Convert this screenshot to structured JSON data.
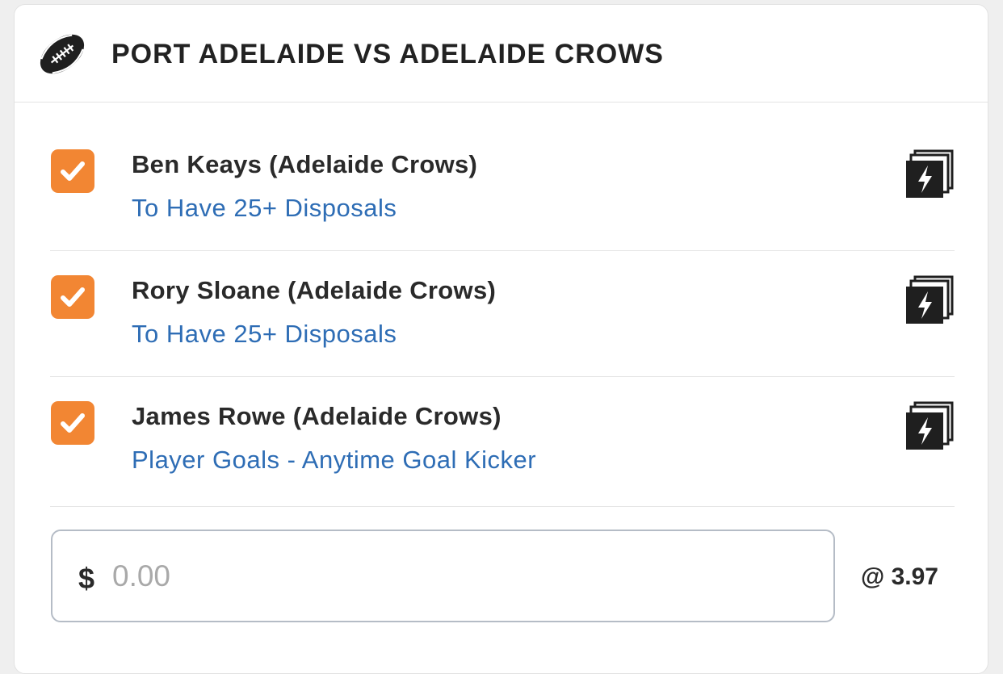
{
  "match": {
    "title": "PORT ADELAIDE VS ADELAIDE CROWS",
    "icon": "football-icon"
  },
  "selections": [
    {
      "player": "Ben Keays (Adelaide Crows)",
      "market": "To Have 25+ Disposals",
      "checked": true
    },
    {
      "player": "Rory Sloane (Adelaide Crows)",
      "market": "To Have 25+ Disposals",
      "checked": true
    },
    {
      "player": "James Rowe (Adelaide Crows)",
      "market": "Player Goals - Anytime Goal Kicker",
      "checked": true
    }
  ],
  "stake": {
    "currency": "$",
    "placeholder": "0.00",
    "value": ""
  },
  "odds": "@ 3.97",
  "colors": {
    "checkbox": "#f28633",
    "market_link": "#2e6db5",
    "text": "#2a2a2a"
  }
}
